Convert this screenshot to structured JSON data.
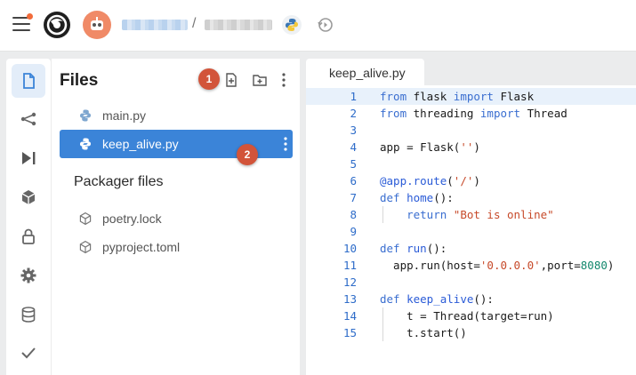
{
  "topbar": {
    "menu_icon": "hamburger-icon",
    "logo_icon": "replit-logo-icon",
    "avatar_icon": "robot-avatar-icon",
    "breadcrumb_separator": "/",
    "language_icon": "python-icon",
    "history_icon": "history-icon"
  },
  "rail": {
    "items": [
      {
        "icon": "file-icon",
        "active": true
      },
      {
        "icon": "share-icon"
      },
      {
        "icon": "run-icon"
      },
      {
        "icon": "package-icon"
      },
      {
        "icon": "lock-icon"
      },
      {
        "icon": "gear-icon"
      },
      {
        "icon": "database-icon"
      },
      {
        "icon": "check-icon"
      }
    ]
  },
  "files": {
    "title": "Files",
    "actions": [
      "new-file-icon",
      "new-folder-icon",
      "more-icon"
    ],
    "items": [
      {
        "name": "main.py",
        "icon": "python-icon",
        "selected": false
      },
      {
        "name": "keep_alive.py",
        "icon": "python-icon",
        "selected": true
      }
    ],
    "packager_title": "Packager files",
    "packager_items": [
      {
        "name": "poetry.lock",
        "icon": "package-icon"
      },
      {
        "name": "pyproject.toml",
        "icon": "package-icon"
      }
    ],
    "badges": [
      "1",
      "2"
    ]
  },
  "editor": {
    "tab_label": "keep_alive.py",
    "highlighted_line": 1,
    "lines": [
      "from flask import Flask",
      "from threading import Thread",
      "",
      "app = Flask('')",
      "",
      "@app.route('/')",
      "def home():",
      "    return \"Bot is online\"",
      "",
      "def run():",
      "  app.run(host='0.0.0.0',port=8080)",
      "",
      "def keep_alive():",
      "    t = Thread(target=run)",
      "    t.start()"
    ]
  },
  "colors": {
    "accent": "#3b84d8",
    "badge": "#d2543a",
    "line_number": "#2e6cc9"
  }
}
